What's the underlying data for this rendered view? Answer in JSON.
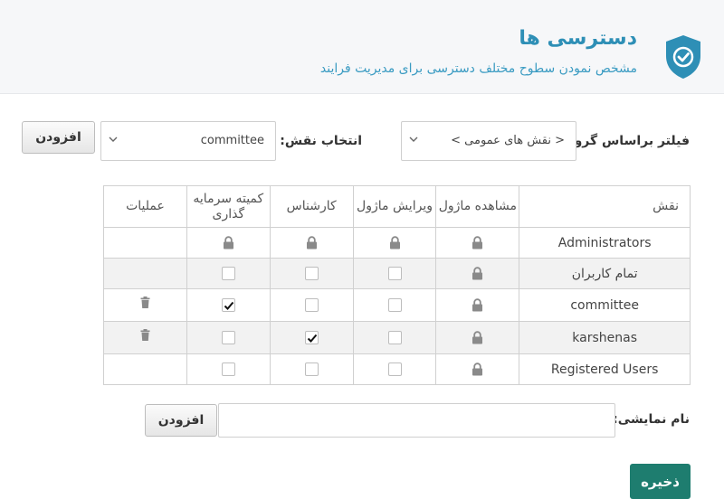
{
  "header": {
    "title": "دسترسی ها",
    "subtitle": "مشخص نمودن سطوح مختلف دسترسی برای مدیریت فرایند",
    "icon": "shield-check-icon",
    "accent_color": "#2e8fb6"
  },
  "filters": {
    "group_label": "فیلتر براساس گروه:",
    "group_value": "< نقش های عمومی >",
    "role_label": "انتخاب نقش:",
    "role_value": "committee",
    "add_label": "افزودن"
  },
  "table": {
    "headers": {
      "role": "نقش",
      "view_module": "مشاهده ماژول",
      "edit_module": "ویرایش ماژول",
      "expert": "کارشناس",
      "investment_committee": "کمیته سرمایه گذاری",
      "operations": "عملیات"
    },
    "rows": [
      {
        "role": "Administrators",
        "view": "locked",
        "edit": "locked",
        "expert": "locked",
        "committee": "locked",
        "deletable": false
      },
      {
        "role": "تمام کاربران",
        "view": "locked",
        "edit": "unchecked",
        "expert": "unchecked",
        "committee": "unchecked",
        "deletable": false
      },
      {
        "role": "committee",
        "view": "locked",
        "edit": "unchecked",
        "expert": "unchecked",
        "committee": "checked",
        "deletable": true
      },
      {
        "role": "karshenas",
        "view": "locked",
        "edit": "unchecked",
        "expert": "checked",
        "committee": "unchecked",
        "deletable": true
      },
      {
        "role": "Registered Users",
        "view": "locked",
        "edit": "unchecked",
        "expert": "unchecked",
        "committee": "unchecked",
        "deletable": false
      }
    ]
  },
  "display_name": {
    "label": "نام نمایشی:",
    "value": "",
    "add_label": "افزودن"
  },
  "save_label": "ذخیره",
  "colors": {
    "save_button": "#1e7d6f",
    "lock": "#8a8a8a",
    "alt_row": "#f2f2f2"
  }
}
